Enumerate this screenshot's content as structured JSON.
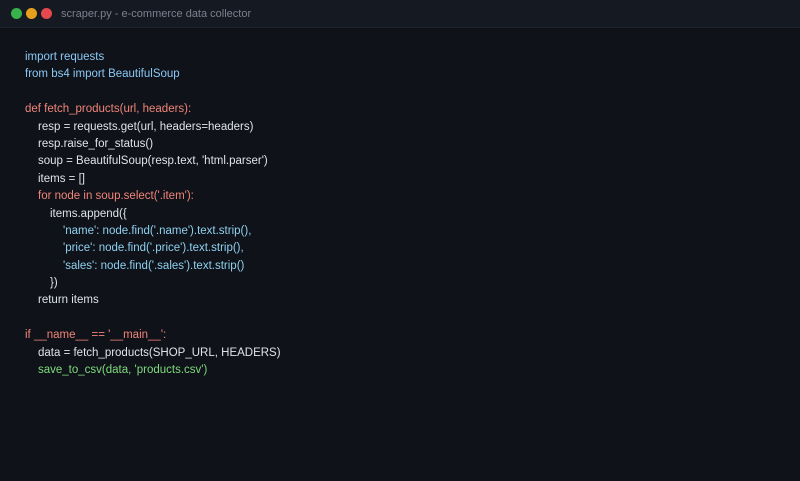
{
  "window": {
    "title": "scraper.py - e-commerce data collector",
    "controls": [
      "green",
      "yellow",
      "red"
    ],
    "colors": {
      "background": "#0f1218",
      "titlebar": "#151922",
      "green": "#37b24d",
      "yellow": "#e5a11c",
      "red": "#e5484d"
    }
  },
  "code": {
    "l1": "import requests",
    "l2": "from bs4 import BeautifulSoup",
    "l3": "",
    "l4": "def fetch_products(url, headers):",
    "l5": "resp = requests.get(url, headers=headers)",
    "l6": "resp.raise_for_status()",
    "l7": "soup = BeautifulSoup(resp.text, 'html.parser')",
    "l8": "items = []",
    "l9": "for node in soup.select('.item'):",
    "l10": "items.append({",
    "l11": "'name': node.find('.name').text.strip(),",
    "l12": "'price': node.find('.price').text.strip(),",
    "l13": "'sales': node.find('.sales').text.strip()",
    "l14": "})",
    "l15": "return items",
    "l16": "",
    "l17": "if __name__ == '__main__':",
    "l18": "data = fetch_products(SHOP_URL, HEADERS)",
    "l19": "save_to_csv(data, 'products.csv')"
  }
}
